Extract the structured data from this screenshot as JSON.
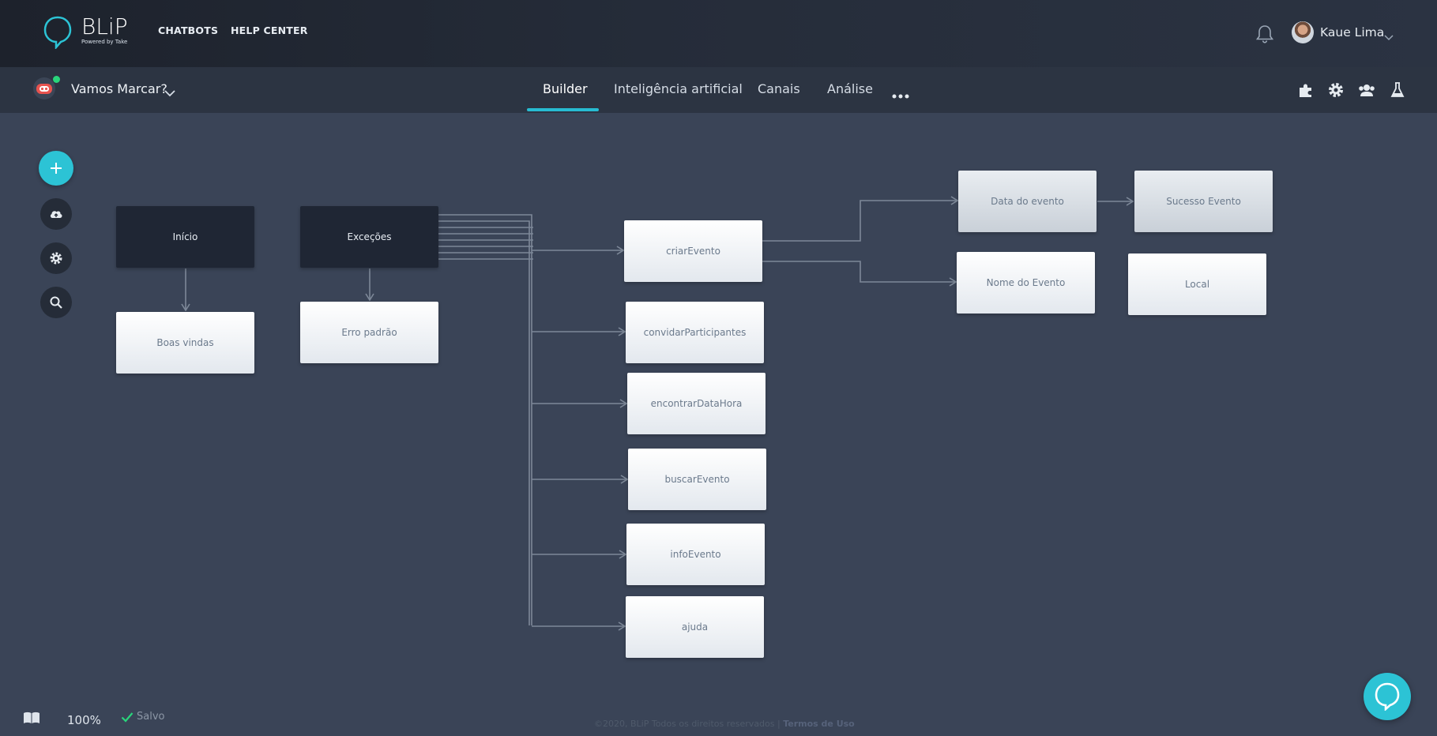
{
  "brand": {
    "name": "BLiP",
    "tagline": "Powered by Take",
    "accent": "#2cc3d5"
  },
  "topnav": {
    "links": [
      "CHATBOTS",
      "HELP CENTER"
    ],
    "user_name": "Kaue Lima"
  },
  "bot": {
    "name": "Vamos Marcar?",
    "status_color": "#29d57b"
  },
  "tabs": [
    {
      "label": "Builder",
      "active": true
    },
    {
      "label": "Inteligência artificial",
      "active": false
    },
    {
      "label": "Canais",
      "active": false
    },
    {
      "label": "Análise",
      "active": false
    }
  ],
  "header_icons": [
    "puzzle-icon",
    "gear-icon",
    "users-icon",
    "flask-icon"
  ],
  "toolbar_icons": [
    "plus-icon",
    "cloud-upload-icon",
    "gear-icon",
    "search-icon"
  ],
  "blocks": {
    "inicio": "Início",
    "excecoes": "Exceções",
    "boas_vindas": "Boas vindas",
    "erro_padrao": "Erro padrão",
    "criar_evento": "criarEvento",
    "convidar_participantes": "convidarParticipantes",
    "encontrar_data_hora": "encontrarDataHora",
    "buscar_evento": "buscarEvento",
    "info_evento": "infoEvento",
    "ajuda": "ajuda",
    "data_do_evento": "Data do evento",
    "sucesso_evento": "Sucesso Evento",
    "nome_do_evento": "Nome do Evento",
    "local": "Local"
  },
  "status": {
    "zoom": "100%",
    "saved": "Salvo"
  },
  "footer": {
    "copyright": "©2020, BLiP Todos os direitos reservados | ",
    "terms": "Termos de Uso"
  }
}
